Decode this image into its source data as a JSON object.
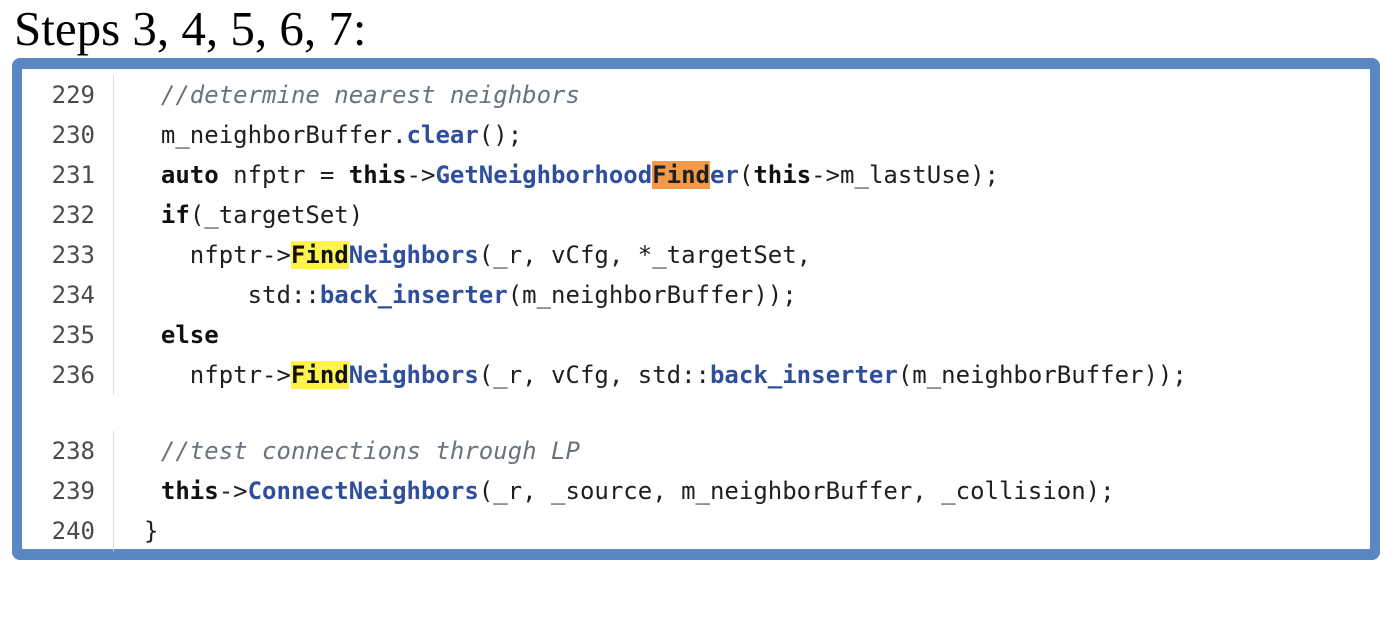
{
  "title": "Steps 3, 4, 5, 6, 7:",
  "colors": {
    "frame": "#5b86c4",
    "function": "#2f4f9d",
    "comment": "#6a737d",
    "highlight_yellow": "#fff34d",
    "highlight_orange": "#f39a4a"
  },
  "lines": [
    {
      "number": "229",
      "indent": "  ",
      "tokens": [
        "//determine nearest neighbors"
      ]
    },
    {
      "number": "230",
      "indent": "  ",
      "tokens": [
        "m_neighborBuffer.",
        "clear",
        "();"
      ]
    },
    {
      "number": "231",
      "indent": "  ",
      "tokens": [
        "auto",
        " nfptr = ",
        "this",
        "->",
        "GetNeighborhood",
        "Find",
        "er",
        "(",
        "this",
        "->m_lastUse);"
      ]
    },
    {
      "number": "232",
      "indent": "  ",
      "tokens": [
        "if",
        "(_targetSet)"
      ]
    },
    {
      "number": "233",
      "indent": "    ",
      "tokens": [
        "nfptr->",
        "Find",
        "Neighbors",
        "(_r, vCfg, *_targetSet,"
      ]
    },
    {
      "number": "234",
      "indent": "        ",
      "tokens": [
        "std::",
        "back_inserter",
        "(m_neighborBuffer));"
      ]
    },
    {
      "number": "235",
      "indent": "  ",
      "tokens": [
        "else"
      ]
    },
    {
      "number": "236",
      "indent": "    ",
      "tokens": [
        "nfptr->",
        "Find",
        "Neighbors",
        "(_r, vCfg, std::",
        "back_inserter",
        "(m_neighborBuffer));"
      ]
    },
    {
      "number": "238",
      "indent": "  ",
      "tokens": [
        "//test connections through LP"
      ]
    },
    {
      "number": "239",
      "indent": "  ",
      "tokens": [
        "this",
        "->",
        "ConnectNeighbors",
        "(_r, _source, m_neighborBuffer, _collision);"
      ]
    },
    {
      "number": "240",
      "indent": "",
      "tokens": [
        "}"
      ]
    }
  ]
}
